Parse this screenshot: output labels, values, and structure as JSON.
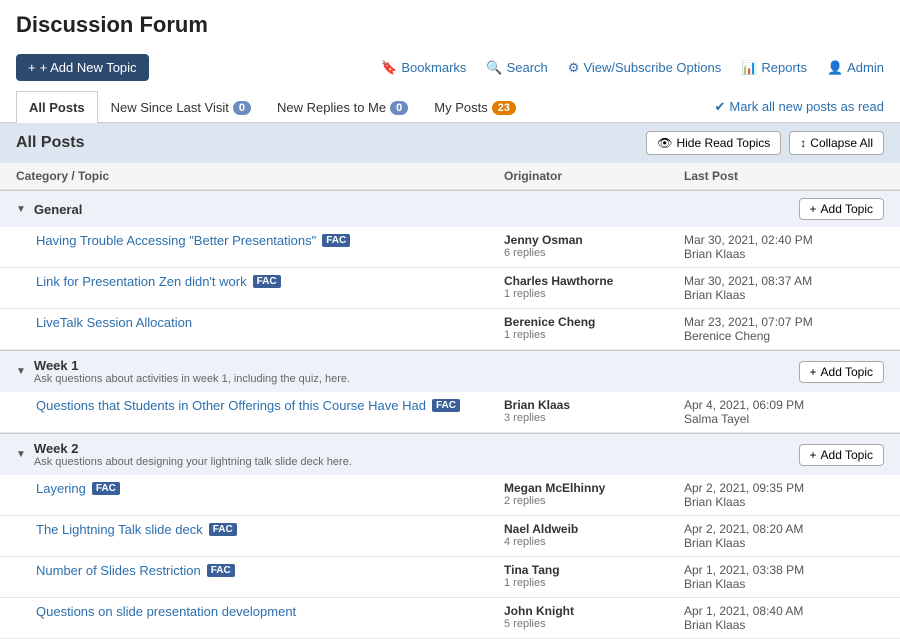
{
  "page": {
    "title": "Discussion Forum"
  },
  "toolbar": {
    "add_new_topic": "+ Add New Topic",
    "bookmarks": "Bookmarks",
    "search": "Search",
    "view_subscribe": "View/Subscribe Options",
    "reports": "Reports",
    "admin": "Admin"
  },
  "tabs": [
    {
      "id": "all-posts",
      "label": "All Posts",
      "badge": null,
      "active": true
    },
    {
      "id": "new-since",
      "label": "New Since Last Visit",
      "badge": "0",
      "active": false
    },
    {
      "id": "new-replies",
      "label": "New Replies to Me",
      "badge": "0",
      "active": false
    },
    {
      "id": "my-posts",
      "label": "My Posts",
      "badge": "23",
      "active": false
    }
  ],
  "mark_all": "Mark all new posts as read",
  "section": {
    "title": "All Posts",
    "hide_read": "Hide Read Topics",
    "collapse_all": "Collapse All"
  },
  "table_headers": {
    "topic": "Category / Topic",
    "originator": "Originator",
    "last_post": "Last Post"
  },
  "categories": [
    {
      "id": "general",
      "name": "General",
      "desc": "",
      "posts": [
        {
          "title": "Having Trouble Accessing \"Better Presentations\"",
          "fac": true,
          "originator_name": "Jenny Osman",
          "originator_replies": "6 replies",
          "last_post_date": "Mar 30, 2021, 02:40 PM",
          "last_post_by": "Brian Klaas"
        },
        {
          "title": "Link for Presentation Zen didn't work",
          "fac": true,
          "originator_name": "Charles Hawthorne",
          "originator_replies": "1 replies",
          "last_post_date": "Mar 30, 2021, 08:37 AM",
          "last_post_by": "Brian Klaas"
        },
        {
          "title": "LiveTalk Session Allocation",
          "fac": false,
          "originator_name": "Berenice Cheng",
          "originator_replies": "1 replies",
          "last_post_date": "Mar 23, 2021, 07:07 PM",
          "last_post_by": "Berenice Cheng"
        }
      ]
    },
    {
      "id": "week1",
      "name": "Week 1",
      "desc": "Ask questions about activities in week 1, including the quiz, here.",
      "posts": [
        {
          "title": "Questions that Students in Other Offerings of this Course Have Had",
          "fac": true,
          "originator_name": "Brian Klaas",
          "originator_replies": "3 replies",
          "last_post_date": "Apr 4, 2021, 06:09 PM",
          "last_post_by": "Salma Tayel"
        }
      ]
    },
    {
      "id": "week2",
      "name": "Week 2",
      "desc": "Ask questions about designing your lightning talk slide deck here.",
      "posts": [
        {
          "title": "Layering",
          "fac": true,
          "originator_name": "Megan McElhinny",
          "originator_replies": "2 replies",
          "last_post_date": "Apr 2, 2021, 09:35 PM",
          "last_post_by": "Brian Klaas"
        },
        {
          "title": "The Lightning Talk slide deck",
          "fac": true,
          "originator_name": "Nael Aldweib",
          "originator_replies": "4 replies",
          "last_post_date": "Apr 2, 2021, 08:20 AM",
          "last_post_by": "Brian Klaas"
        },
        {
          "title": "Number of Slides Restriction",
          "fac": true,
          "originator_name": "Tina Tang",
          "originator_replies": "1 replies",
          "last_post_date": "Apr 1, 2021, 03:38 PM",
          "last_post_by": "Brian Klaas"
        },
        {
          "title": "Questions on slide presentation development",
          "fac": false,
          "originator_name": "John Knight",
          "originator_replies": "5 replies",
          "last_post_date": "Apr 1, 2021, 08:40 AM",
          "last_post_by": "Brian Klaas"
        }
      ]
    }
  ]
}
